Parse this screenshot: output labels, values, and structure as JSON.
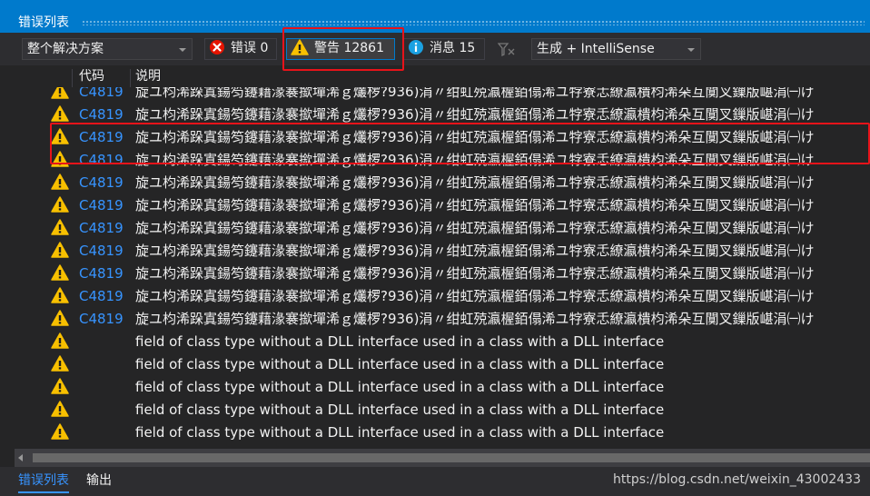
{
  "window": {
    "title": "错误列表"
  },
  "toolbar": {
    "scope_value": "整个解决方案",
    "errors_label": "错误 0",
    "warnings_label": "警告 12861",
    "messages_label": "消息 15",
    "build_filter_value": "生成 + IntelliSense"
  },
  "columns": {
    "code": "代码",
    "description": "说明"
  },
  "rows": [
    {
      "icon": "warning-icon",
      "code": "C4819",
      "description": "旋ユ枃浠跺寘鍚笉鑳藉湪褰撳墠浠ｇ爜椤?936)涓〃绀虹殑瀛楃銆傝浠ユ牸寮忎繚瀛樻枃浠朵互闃叉鏁版嵁涓㈠け"
    },
    {
      "icon": "warning-icon",
      "code": "C4819",
      "description": "旋ユ枃浠跺寘鍚笉鑳藉湪褰撳墠浠ｇ爜椤?936)涓〃绀虹殑瀛楃銆傝浠ユ牸寮忎繚瀛樻枃浠朵互闃叉鏁版嵁涓㈠け"
    },
    {
      "icon": "warning-icon",
      "code": "C4819",
      "description": "旋ユ枃浠跺寘鍚笉鑳藉湪褰撳墠浠ｇ爜椤?936)涓〃绀虹殑瀛楃銆傝浠ユ牸寮忎繚瀛樻枃浠朵互闃叉鏁版嵁涓㈠け"
    },
    {
      "icon": "warning-icon",
      "code": "C4819",
      "description": "旋ユ枃浠跺寘鍚笉鑳藉湪褰撳墠浠ｇ爜椤?936)涓〃绀虹殑瀛楃銆傝浠ユ牸寮忎繚瀛樻枃浠朵互闃叉鏁版嵁涓㈠け"
    },
    {
      "icon": "warning-icon",
      "code": "C4819",
      "description": "旋ユ枃浠跺寘鍚笉鑳藉湪褰撳墠浠ｇ爜椤?936)涓〃绀虹殑瀛楃銆傝浠ユ牸寮忎繚瀛樻枃浠朵互闃叉鏁版嵁涓㈠け"
    },
    {
      "icon": "warning-icon",
      "code": "C4819",
      "description": "旋ユ枃浠跺寘鍚笉鑳藉湪褰撳墠浠ｇ爜椤?936)涓〃绀虹殑瀛楃銆傝浠ユ牸寮忎繚瀛樻枃浠朵互闃叉鏁版嵁涓㈠け"
    },
    {
      "icon": "warning-icon",
      "code": "C4819",
      "description": "旋ユ枃浠跺寘鍚笉鑳藉湪褰撳墠浠ｇ爜椤?936)涓〃绀虹殑瀛楃銆傝浠ユ牸寮忎繚瀛樻枃浠朵互闃叉鏁版嵁涓㈠け"
    },
    {
      "icon": "warning-icon",
      "code": "C4819",
      "description": "旋ユ枃浠跺寘鍚笉鑳藉湪褰撳墠浠ｇ爜椤?936)涓〃绀虹殑瀛楃銆傝浠ユ牸寮忎繚瀛樻枃浠朵互闃叉鏁版嵁涓㈠け"
    },
    {
      "icon": "warning-icon",
      "code": "C4819",
      "description": "旋ユ枃浠跺寘鍚笉鑳藉湪褰撳墠浠ｇ爜椤?936)涓〃绀虹殑瀛楃銆傝浠ユ牸寮忎繚瀛樻枃浠朵互闃叉鏁版嵁涓㈠け"
    },
    {
      "icon": "warning-icon",
      "code": "C4819",
      "description": "旋ユ枃浠跺寘鍚笉鑳藉湪褰撳墠浠ｇ爜椤?936)涓〃绀虹殑瀛楃銆傝浠ユ牸寮忎繚瀛樻枃浠朵互闃叉鏁版嵁涓㈠け"
    },
    {
      "icon": "warning-icon",
      "code": "C4819",
      "description": "旋ユ枃浠跺寘鍚笉鑳藉湪褰撳墠浠ｇ爜椤?936)涓〃绀虹殑瀛楃銆傝浠ユ牸寮忎繚瀛樻枃浠朵互闃叉鏁版嵁涓㈠け"
    },
    {
      "icon": "warning-icon",
      "code": "",
      "description": "field of class type without a DLL interface used in a class with a DLL interface"
    },
    {
      "icon": "warning-icon",
      "code": "",
      "description": "field of class type without a DLL interface used in a class with a DLL interface"
    },
    {
      "icon": "warning-icon",
      "code": "",
      "description": "field of class type without a DLL interface used in a class with a DLL interface"
    },
    {
      "icon": "warning-icon",
      "code": "",
      "description": "field of class type without a DLL interface used in a class with a DLL interface"
    },
    {
      "icon": "warning-icon",
      "code": "",
      "description": "field of class type without a DLL interface used in a class with a DLL interface"
    }
  ],
  "bottom_tabs": {
    "error_list": "错误列表",
    "output": "输出"
  },
  "watermark": "https://blog.csdn.net/weixin_43002433",
  "colors": {
    "accent": "#007acc",
    "warning": "#f8c000",
    "error": "#e51400",
    "info": "#1ba1e2",
    "code_link": "#3794ff",
    "highlight": "#e8131a"
  }
}
